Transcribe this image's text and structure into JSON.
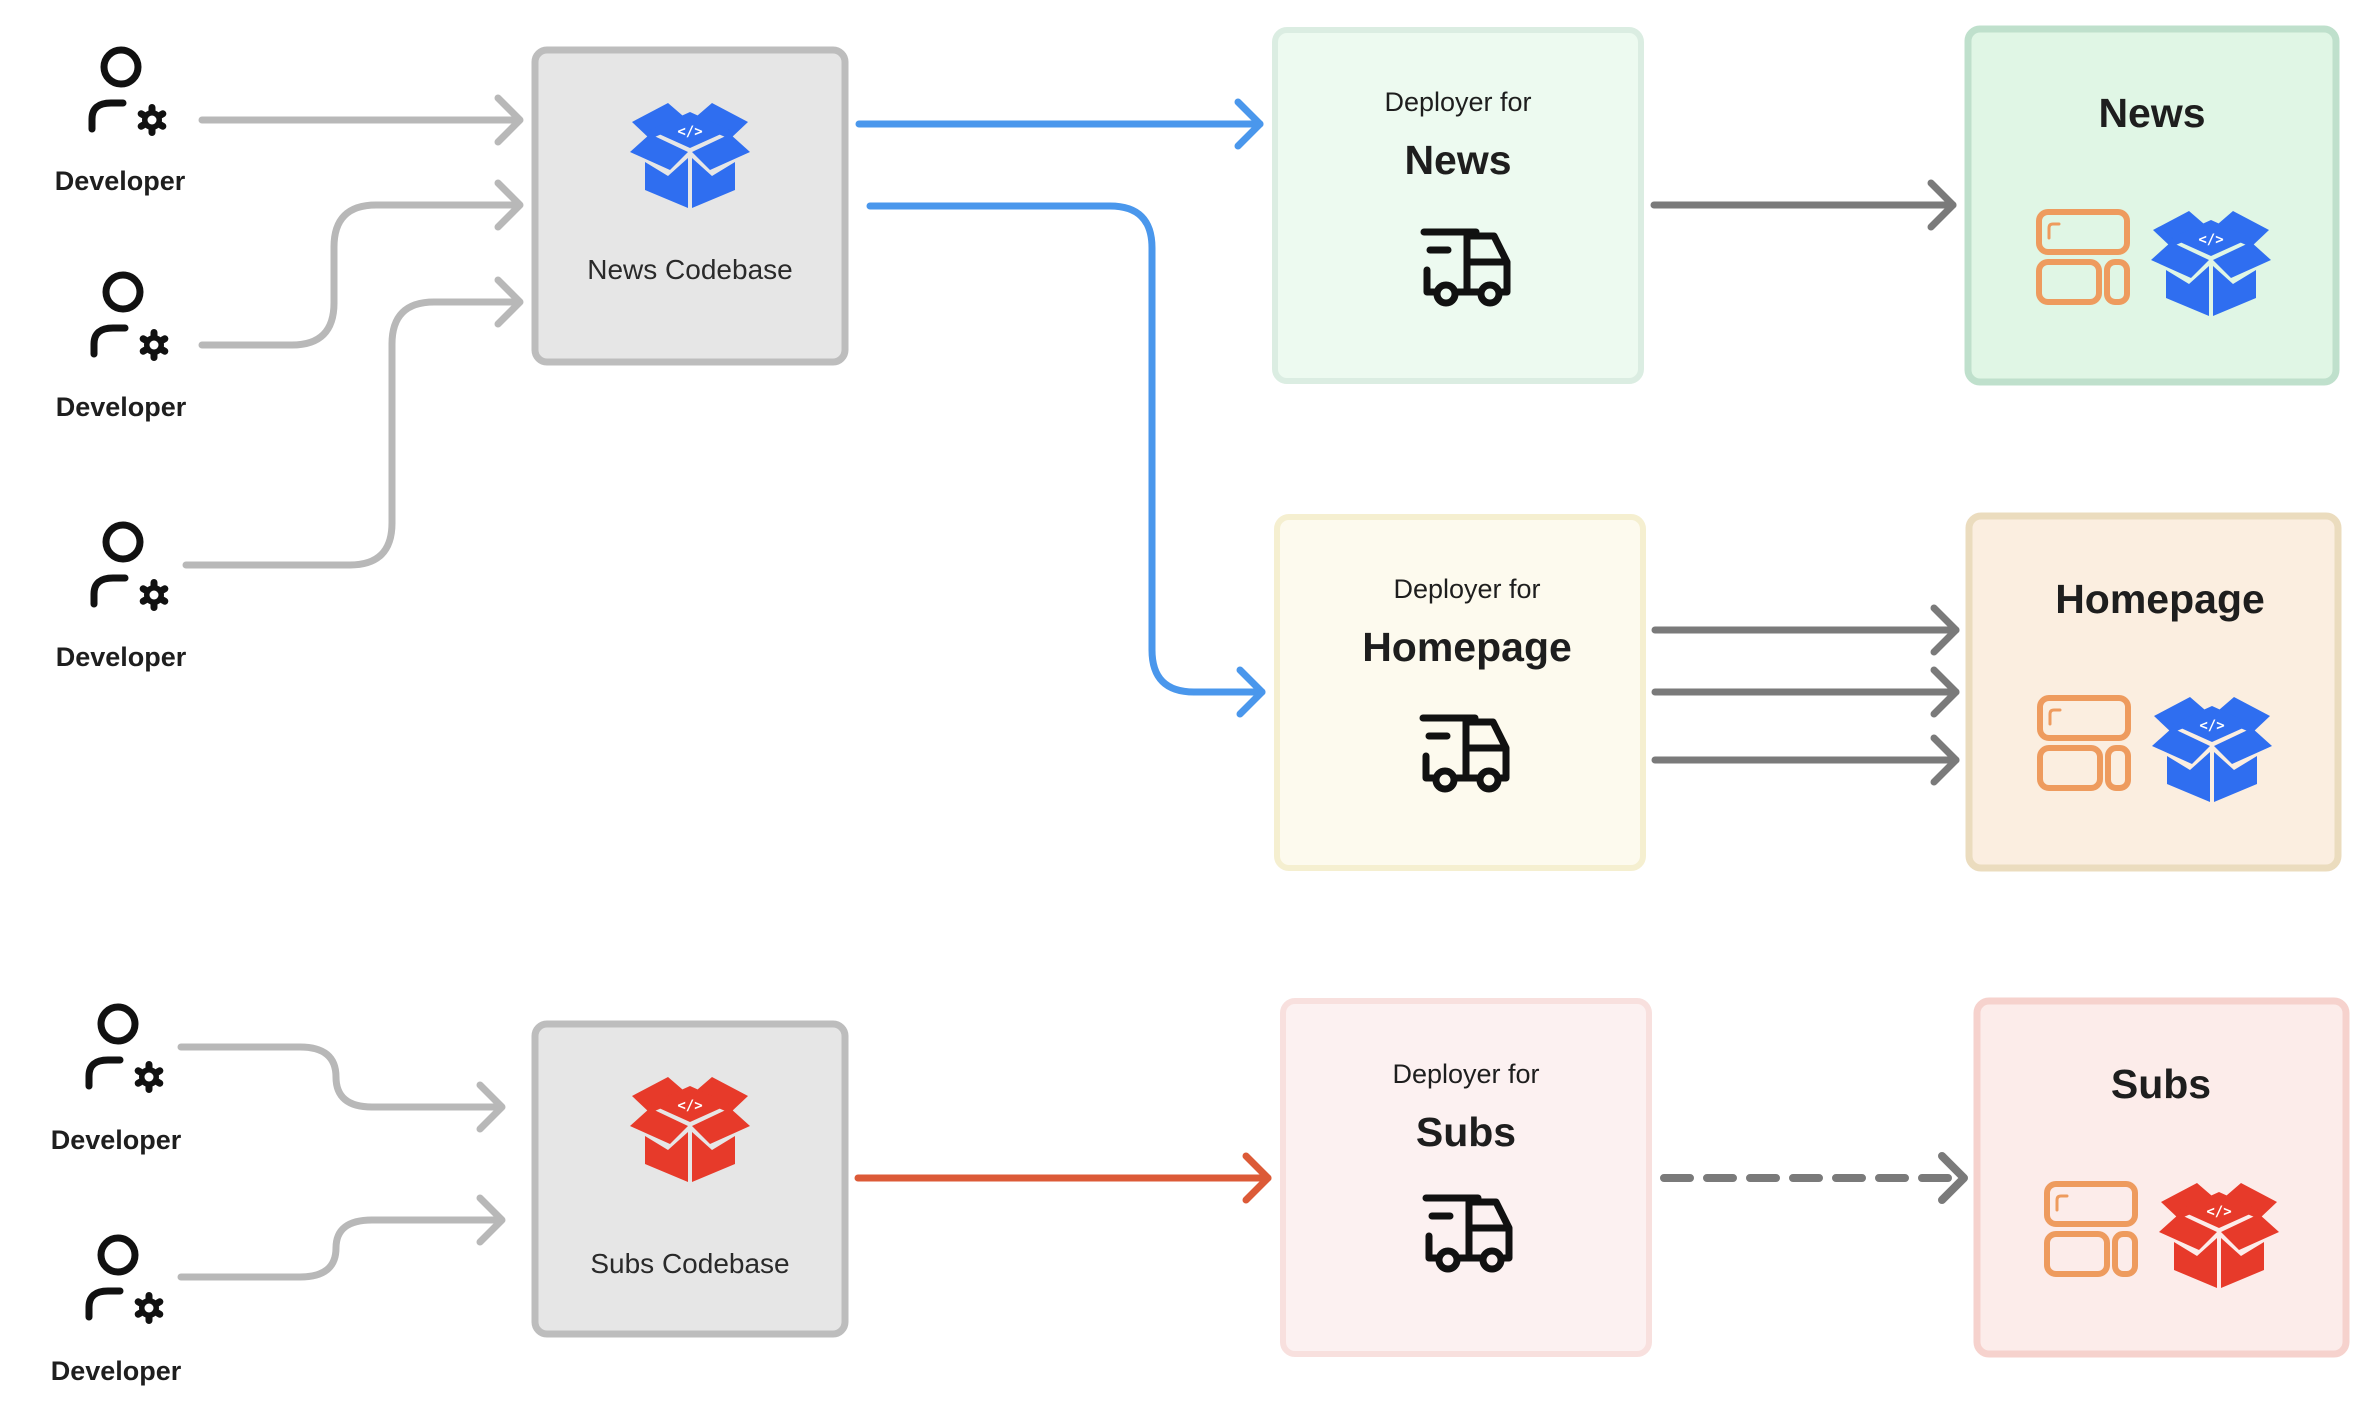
{
  "colors": {
    "blue_flow": "#4a97ec",
    "red_flow": "#dc5a37",
    "gray_in": "#b8b8b8",
    "gray_out": "#7a7a7a",
    "box_blue_icon": "#2f6ef0",
    "box_red_icon": "#e73a2a",
    "layout_icon": "#ee9b5e",
    "ink": "#111111"
  },
  "developers": [
    {
      "label": "Developer"
    },
    {
      "label": "Developer"
    },
    {
      "label": "Developer"
    },
    {
      "label": "Developer"
    },
    {
      "label": "Developer"
    }
  ],
  "codebases": [
    {
      "label": "News Codebase",
      "icon": "code-box-icon",
      "icon_color": "blue"
    },
    {
      "label": "Subs Codebase",
      "icon": "code-box-icon",
      "icon_color": "red"
    }
  ],
  "deployers": [
    {
      "prefix": "Deployer for",
      "name": "News",
      "icon": "delivery-truck-icon",
      "theme": "green"
    },
    {
      "prefix": "Deployer for",
      "name": "Homepage",
      "icon": "delivery-truck-icon",
      "theme": "yellow"
    },
    {
      "prefix": "Deployer for",
      "name": "Subs",
      "icon": "delivery-truck-icon",
      "theme": "red"
    }
  ],
  "apps": [
    {
      "name": "News",
      "icons": [
        "layout-icon",
        "code-box-icon"
      ],
      "theme": "green",
      "box_color": "blue"
    },
    {
      "name": "Homepage",
      "icons": [
        "layout-icon",
        "code-box-icon"
      ],
      "theme": "orange",
      "box_color": "blue"
    },
    {
      "name": "Subs",
      "icons": [
        "layout-icon",
        "code-box-icon"
      ],
      "theme": "red",
      "box_color": "red"
    }
  ],
  "connections": [
    {
      "from": "developer-1",
      "to": "news-codebase",
      "style": "solid",
      "color": "gray_in"
    },
    {
      "from": "developer-2",
      "to": "news-codebase",
      "style": "solid",
      "color": "gray_in"
    },
    {
      "from": "developer-3",
      "to": "news-codebase",
      "style": "solid",
      "color": "gray_in"
    },
    {
      "from": "news-codebase",
      "to": "deployer-news",
      "style": "solid",
      "color": "blue_flow"
    },
    {
      "from": "news-codebase",
      "to": "deployer-homepage",
      "style": "solid",
      "color": "blue_flow"
    },
    {
      "from": "deployer-news",
      "to": "app-news",
      "style": "solid",
      "color": "gray_out"
    },
    {
      "from": "deployer-homepage",
      "to": "app-homepage",
      "style": "solid",
      "color": "gray_out",
      "count": 3
    },
    {
      "from": "developer-4",
      "to": "subs-codebase",
      "style": "solid",
      "color": "gray_in"
    },
    {
      "from": "developer-5",
      "to": "subs-codebase",
      "style": "solid",
      "color": "gray_in"
    },
    {
      "from": "subs-codebase",
      "to": "deployer-subs",
      "style": "solid",
      "color": "red_flow"
    },
    {
      "from": "deployer-subs",
      "to": "app-subs",
      "style": "dashed",
      "color": "gray_out"
    }
  ]
}
